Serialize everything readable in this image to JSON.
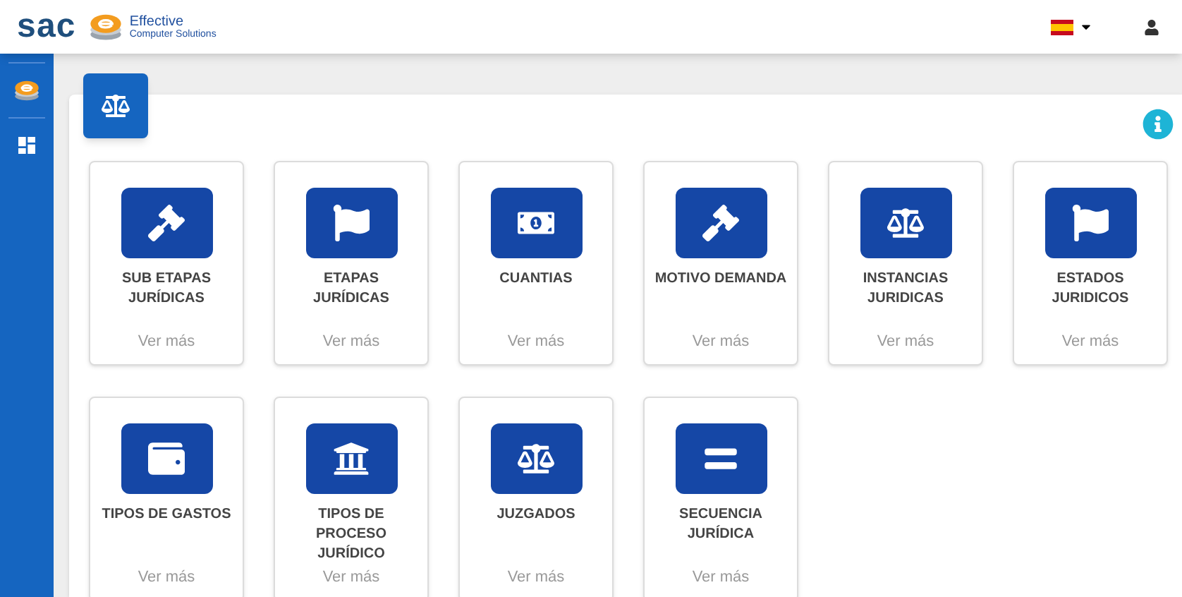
{
  "header": {
    "logo_text": "sac",
    "brand_line_1": "Effective",
    "brand_line_2": "Computer Solutions",
    "language": {
      "kind": "flag_es"
    }
  },
  "sidebar": {
    "items": [
      {
        "kind": "brand",
        "selected": false
      },
      {
        "kind": "dashboard",
        "selected": false
      }
    ]
  },
  "page": {
    "kind": "scale"
  },
  "cards": [
    {
      "title": "SUB ETAPAS\nJURÍDICAS",
      "kind": "gavel",
      "link": "Ver más"
    },
    {
      "title": "ETAPAS\nJURÍDICAS",
      "kind": "flag",
      "link": "Ver más"
    },
    {
      "title": "CUANTIAS",
      "kind": "money",
      "link": "Ver más"
    },
    {
      "title": "MOTIVO DEMANDA",
      "kind": "gavel",
      "link": "Ver más"
    },
    {
      "title": "INSTANCIAS\nJURIDICAS",
      "kind": "scale",
      "link": "Ver más"
    },
    {
      "title": "ESTADOS\nJURIDICOS",
      "kind": "flag",
      "link": "Ver más"
    },
    {
      "title": "TIPOS DE GASTOS",
      "kind": "wallet",
      "link": "Ver más"
    },
    {
      "title": "TIPOS DE\nPROCESO\nJURÍDICO",
      "kind": "bank",
      "link": "Ver más"
    },
    {
      "title": "JUZGADOS",
      "kind": "scale",
      "link": "Ver más"
    },
    {
      "title": "SECUENCIA\nJURÍDICA",
      "kind": "equals",
      "link": "Ver más"
    }
  ]
}
